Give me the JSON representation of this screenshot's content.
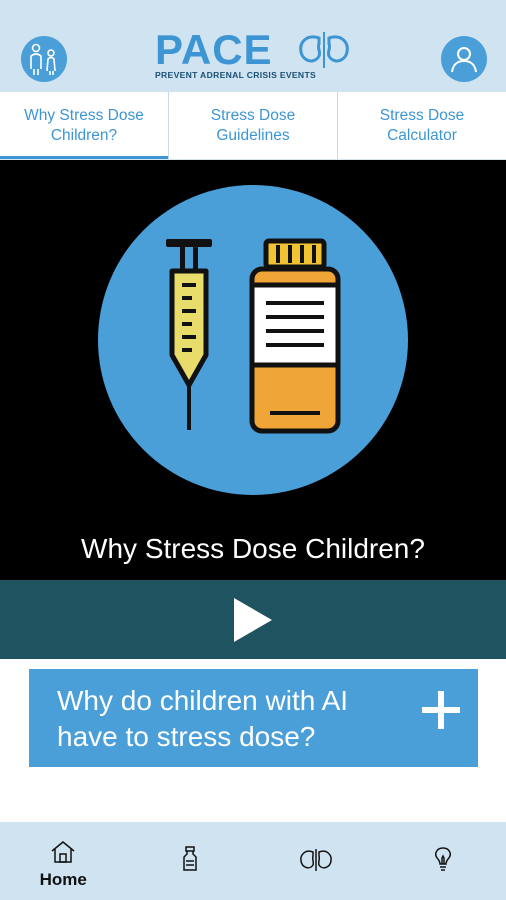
{
  "header": {
    "logo_title": "PACE",
    "logo_subtitle": "PREVENT ADRENAL CRISIS EVENTS",
    "left_icon": "family-icon",
    "right_icon": "user-profile-icon"
  },
  "tabs": [
    {
      "label": "Why Stress Dose Children?",
      "active": true
    },
    {
      "label": "Stress Dose Guidelines",
      "active": false
    },
    {
      "label": "Stress Dose Calculator",
      "active": false
    }
  ],
  "video": {
    "title": "Why Stress Dose Children?",
    "illustration": [
      "syringe-icon",
      "medicine-bottle-icon"
    ],
    "play_icon": "play-icon"
  },
  "accordion": {
    "question": "Why do children with AI have to stress dose?",
    "expand_icon": "plus-icon"
  },
  "bottom_nav": [
    {
      "icon": "home-icon",
      "label": "Home",
      "active": true
    },
    {
      "icon": "medicine-vial-icon",
      "label": ""
    },
    {
      "icon": "kidneys-icon",
      "label": ""
    },
    {
      "icon": "lightbulb-icon",
      "label": ""
    }
  ],
  "colors": {
    "header_bg": "#cfe3f1",
    "accent_blue": "#4a9fd9",
    "logo_blue": "#3d95d4",
    "play_bar": "#1f5360",
    "video_bg": "#000000"
  }
}
